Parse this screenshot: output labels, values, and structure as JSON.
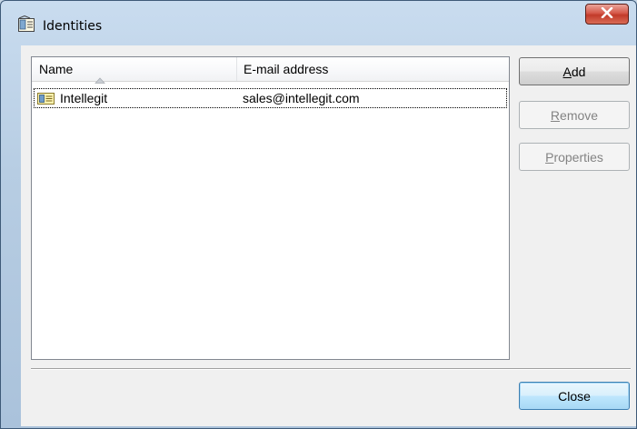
{
  "window": {
    "title": "Identities",
    "close_glyph": "✕"
  },
  "list": {
    "columns": [
      {
        "label": "Name",
        "sort": "ascending"
      },
      {
        "label": "E-mail address"
      }
    ],
    "rows": [
      {
        "icon": "identity-card-icon",
        "name": "Intellegit",
        "email": "sales@intellegit.com",
        "selected": true
      }
    ]
  },
  "buttons": {
    "add": {
      "label": "Add",
      "mnemonic": "A",
      "enabled": true
    },
    "remove": {
      "label": "Remove",
      "mnemonic": "R",
      "enabled": false
    },
    "properties": {
      "label": "Properties",
      "mnemonic": "P",
      "enabled": false
    },
    "close": {
      "label": "Close",
      "enabled": true,
      "default": true
    }
  }
}
